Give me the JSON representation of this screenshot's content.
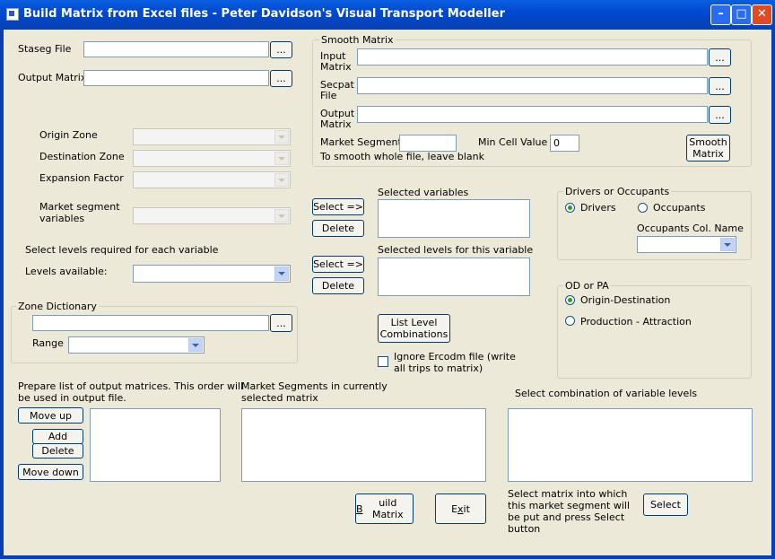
{
  "window": {
    "title": "Build Matrix from Excel files - Peter Davidson's Visual Transport Modeller"
  },
  "labels": {
    "staseg_file": "Staseg File",
    "output_matrix": "Output Matrix",
    "origin_zone": "Origin Zone",
    "destination_zone": "Destination Zone",
    "expansion_factor": "Expansion Factor",
    "market_segment_variables_1": "Market segment",
    "market_segment_variables_2": "variables",
    "select_levels": "Select levels required for each variable",
    "levels_available": "Levels available:",
    "range": "Range",
    "prepare_list_1": "Prepare list of output matrices. This order will",
    "prepare_list_2": "be used in output file.",
    "market_segments_1": "Market Segments in currently",
    "market_segments_2": "selected matrix",
    "select_combination": "Select combination of variable levels",
    "select_matrix_1": "Select matrix into which",
    "select_matrix_2": "this market segment will",
    "select_matrix_3": "be put and press Select",
    "select_matrix_4": "button",
    "selected_variables": "Selected variables",
    "selected_levels": "Selected levels for this variable",
    "ignore_1": "Ignore Ercodm file (write",
    "ignore_2": "all trips to matrix)"
  },
  "smooth": {
    "group": "Smooth Matrix",
    "input_1": "Input",
    "input_2": "Matrix",
    "secpat_1": "Secpat",
    "secpat_2": "File",
    "output_1": "Output",
    "output_2": "Matrix",
    "market_segment": "Market Segment",
    "smooth_hint": "To smooth whole file, leave blank",
    "min_cell": "Min Cell Value",
    "min_cell_value": "0",
    "button_1": "Smooth",
    "button_2": "Matrix"
  },
  "zone_dictionary": {
    "group": "Zone Dictionary"
  },
  "drivers": {
    "group": "Drivers or Occupants",
    "drivers": "Drivers",
    "occupants": "Occupants",
    "col_name": "Occupants Col. Name"
  },
  "odpa": {
    "group": "OD or PA",
    "od": "Origin-Destination",
    "pa": "Production - Attraction"
  },
  "buttons": {
    "browse": "...",
    "select_arrow": "Select =>",
    "delete": "Delete",
    "list_level_1": "List Level",
    "list_level_2": "Combinations",
    "move_up": "Move up",
    "add": "Add",
    "move_down": "Move down",
    "build_u": "B",
    "build_rest": "uild Matrix",
    "exit_pre": "E",
    "exit_u": "x",
    "exit_rest": "it",
    "select": "Select"
  }
}
